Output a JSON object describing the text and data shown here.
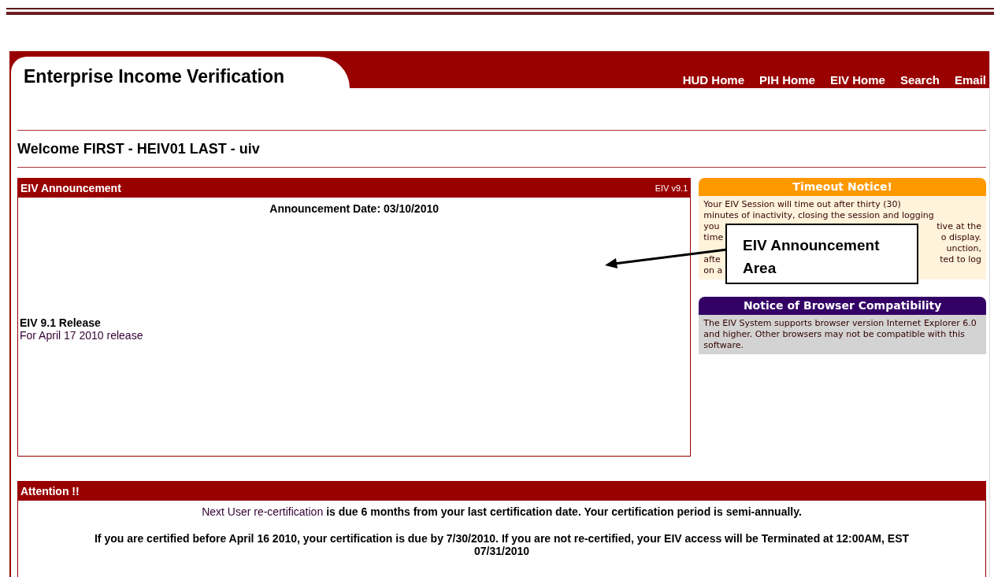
{
  "header": {
    "title": "Enterprise Income Verification",
    "nav": [
      "HUD Home",
      "PIH Home",
      "EIV Home",
      "Search",
      "Email"
    ]
  },
  "welcome": "Welcome FIRST - HEIV01 LAST - uiv",
  "announcement": {
    "title": "EIV Announcement",
    "version": "EIV v9.1",
    "date": "Announcement Date: 03/10/2010",
    "items": [
      {
        "title": "EIV 9.1 Release",
        "text": "For April 17 2010 release"
      }
    ]
  },
  "timeout": {
    "title": "Timeout Notice!",
    "lines": [
      {
        "left": "Your EIV Session will time out after thirty (30)"
      },
      {
        "left": "minutes of inactivity, closing the session and logging"
      },
      {
        "left": "you",
        "right": "tive at the"
      },
      {
        "left": "time",
        "right": "o display."
      },
      {
        "right": "unction,"
      },
      {
        "left": "afte",
        "right": "ted to log"
      },
      {
        "left": "on a"
      }
    ]
  },
  "compatibility": {
    "title": "Notice of Browser Compatibility",
    "text": "The EIV System supports browser version Internet Explorer 6.0 and higher. Other browsers may not be compatible with this software."
  },
  "attention": {
    "title": "Attention !!",
    "link": "Next User re-certification",
    "line1": "is due 6 months from your last certification date. Your certification period is semi-annually.",
    "line2": "If you are certified before April 16 2010, your certification is due by 7/30/2010. If you are not re-certified, your EIV access will be Terminated at 12:00AM, EST 07/31/2010"
  },
  "callout": {
    "text": "EIV Announcement Area"
  }
}
